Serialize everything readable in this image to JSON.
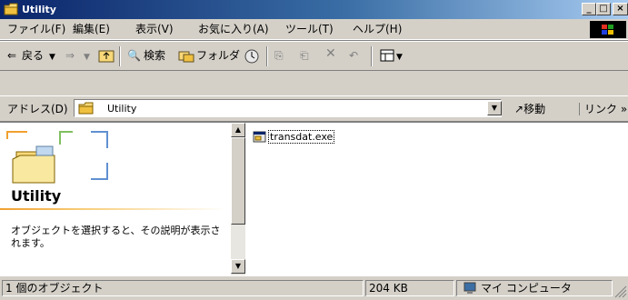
{
  "window": {
    "title": "Utility"
  },
  "menu": [
    "ファイル(F)",
    "編集(E)",
    "表示(V)",
    "お気に入り(A)",
    "ツール(T)",
    "ヘルプ(H)"
  ],
  "toolbar": {
    "back": "戻る",
    "search": "検索",
    "folders": "フォルダ"
  },
  "address": {
    "label": "アドレス(D)",
    "value": "Utility",
    "go": "移動",
    "links": "リンク »"
  },
  "leftpane": {
    "folder_name": "Utility",
    "description": "オブジェクトを選択すると、その説明が表示されます。"
  },
  "files": [
    {
      "name": "transdat.exe",
      "icon": "exe-icon"
    }
  ],
  "status": {
    "count": "1 個のオブジェクト",
    "size": "204 KB",
    "zone": "マイ コンピュータ"
  },
  "colors": {
    "titlebar_start": "#0a246a",
    "titlebar_end": "#a6caf0",
    "face": "#d4d0c8"
  }
}
